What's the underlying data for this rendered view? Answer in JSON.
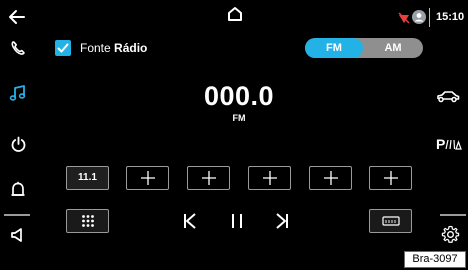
{
  "topbar": {
    "back_icon": "arrow-left-icon",
    "home_icon": "house-icon",
    "status_icons": [
      "mute-indicator-icon",
      "profile-icon"
    ],
    "clock": "15:10"
  },
  "sidebar_left": {
    "items": [
      {
        "name": "phone",
        "icon": "phone-icon"
      },
      {
        "name": "media",
        "icon": "music-note-icon",
        "active": true
      },
      {
        "name": "power",
        "icon": "power-icon"
      },
      {
        "name": "notifications",
        "icon": "bell-icon"
      },
      {
        "name": "sound",
        "icon": "speaker-icon"
      }
    ]
  },
  "sidebar_right": {
    "items": [
      {
        "name": "vehicle",
        "icon": "car-icon"
      },
      {
        "name": "park-assist",
        "icon": "park-assist-icon",
        "label": "P"
      },
      {
        "name": "settings",
        "icon": "gear-icon"
      }
    ]
  },
  "source": {
    "prefix": "Fonte",
    "value": "Rádio"
  },
  "band": {
    "options": [
      "FM",
      "AM"
    ],
    "selected": "FM"
  },
  "frequency": {
    "value": "000.0",
    "unit": "FM"
  },
  "presets": [
    {
      "label": "11.1"
    },
    {
      "label": ""
    },
    {
      "label": ""
    },
    {
      "label": ""
    },
    {
      "label": ""
    },
    {
      "label": ""
    }
  ],
  "controls": {
    "grid_icon": "keypad-grid-icon",
    "prev_icon": "skip-previous-icon",
    "pause_icon": "pause-icon",
    "next_icon": "skip-next-icon",
    "station_list_icon": "radio-list-icon"
  },
  "colors": {
    "accent": "#23b2e6",
    "background": "#000000",
    "mute_indicator": "#e8413b"
  },
  "figure_ref": "Bra-3097"
}
